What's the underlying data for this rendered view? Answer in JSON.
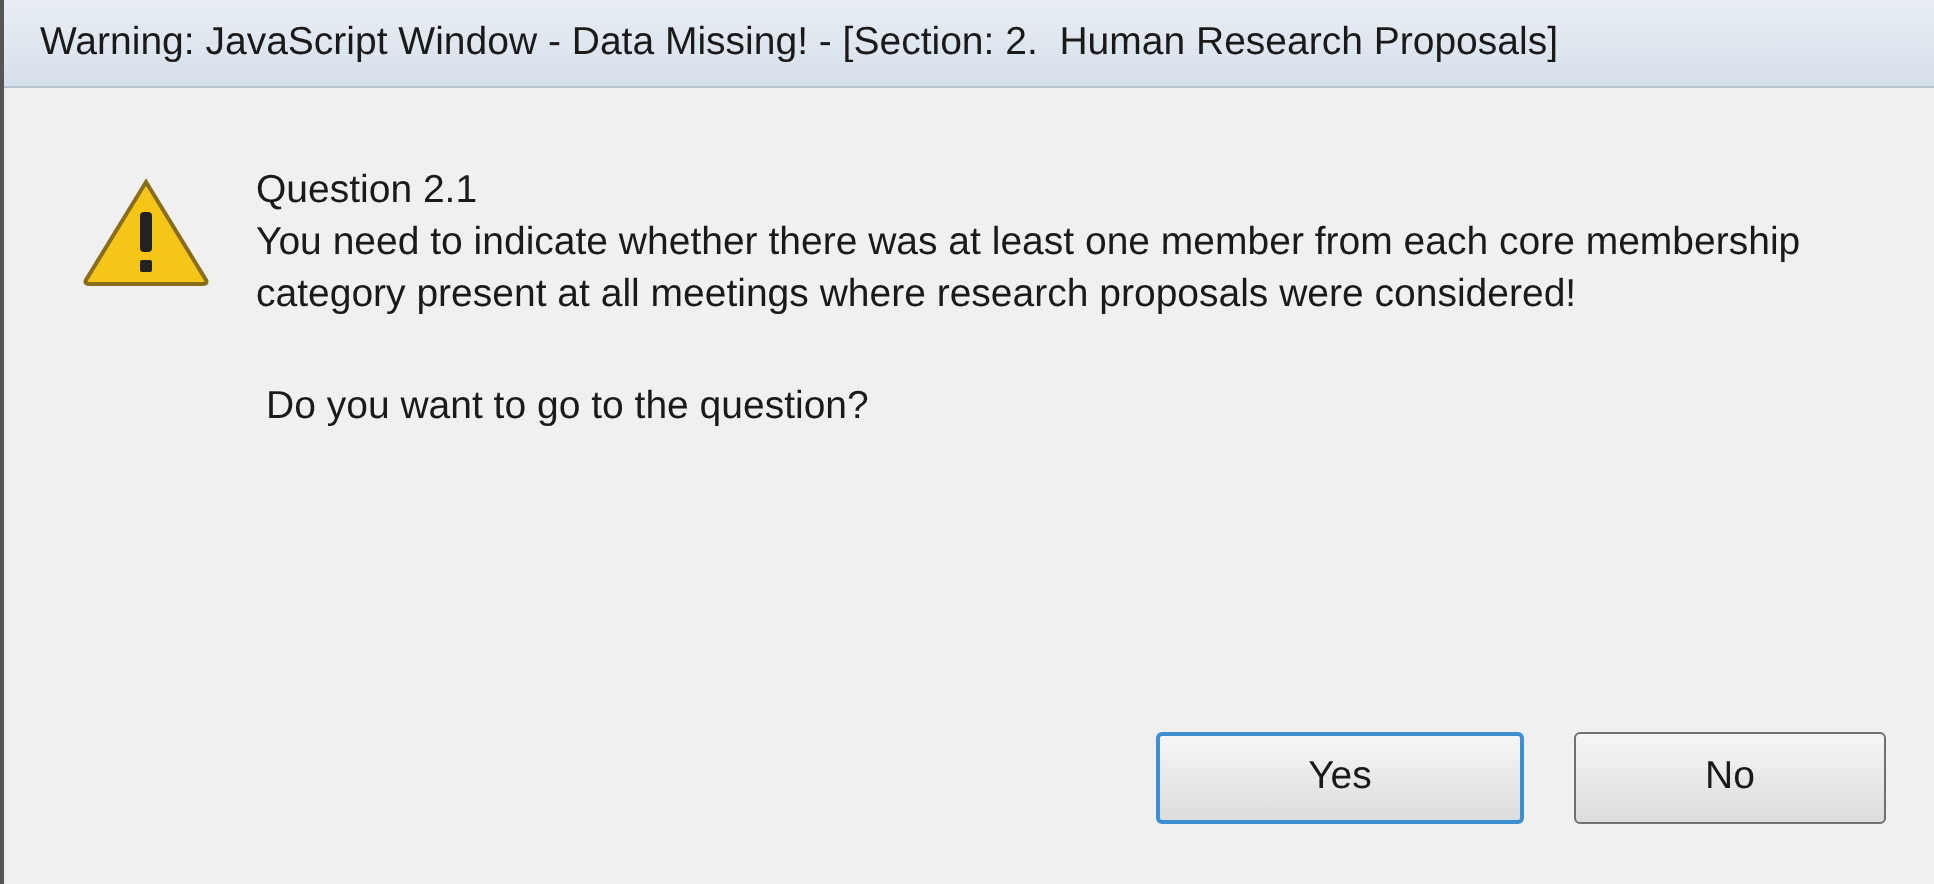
{
  "window": {
    "title": "Warning: JavaScript Window - Data Missing! - [Section: 2.  Human Research Proposals]"
  },
  "message": {
    "heading": "Question 2.1",
    "body": "You need to indicate whether there was at least one member from each core membership category present at all meetings where research proposals were considered!",
    "prompt": "Do you want to go to the question?"
  },
  "buttons": [
    {
      "label": "Yes",
      "focused": true
    },
    {
      "label": "No",
      "focused": false
    }
  ]
}
